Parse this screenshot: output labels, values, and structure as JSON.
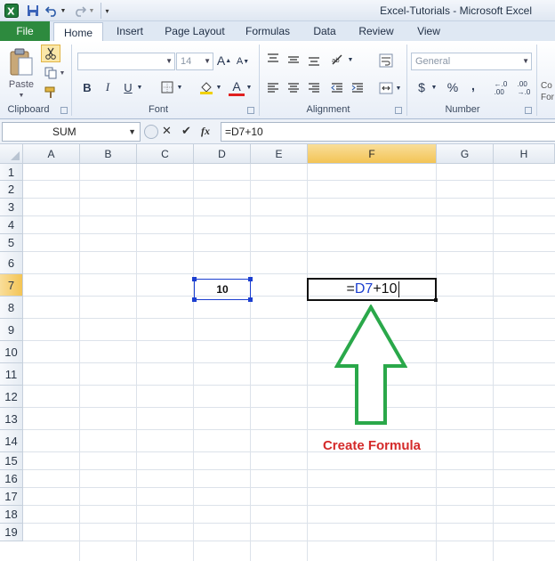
{
  "window": {
    "title": "Excel-Tutorials  -  Microsoft Excel"
  },
  "tabs": [
    {
      "label": "File"
    },
    {
      "label": "Home"
    },
    {
      "label": "Insert"
    },
    {
      "label": "Page Layout"
    },
    {
      "label": "Formulas"
    },
    {
      "label": "Data"
    },
    {
      "label": "Review"
    },
    {
      "label": "View"
    }
  ],
  "ribbon": {
    "clipboard": {
      "label": "Clipboard",
      "paste_label": "Paste"
    },
    "font": {
      "label": "Font",
      "font_name": "",
      "font_size": "14",
      "bold": "B",
      "italic": "I",
      "underline": "U"
    },
    "alignment": {
      "label": "Alignment"
    },
    "number": {
      "label": "Number",
      "format": "General",
      "currency": "$",
      "percent": "%",
      "comma": ",",
      "inc_decimal": "←.0\n.00",
      "dec_decimal": ".00\n→.0"
    },
    "styles": {
      "label_partial": "Co\nFor"
    }
  },
  "formula_bar": {
    "name_box": "SUM",
    "cancel_glyph": "✕",
    "enter_glyph": "✔",
    "fx_glyph": "fx",
    "formula": "=D7+10"
  },
  "sheet": {
    "columns": [
      "A",
      "B",
      "C",
      "D",
      "E",
      "F",
      "G",
      "H"
    ],
    "active_column": "F",
    "rows": [
      "1",
      "2",
      "3",
      "4",
      "5",
      "6",
      "7",
      "8",
      "9",
      "10",
      "11",
      "12",
      "13",
      "14",
      "15",
      "16",
      "17",
      "18",
      "19"
    ],
    "active_row": "7",
    "cells": {
      "D7": "10",
      "F7_prefix": "=",
      "F7_ref": "D7",
      "F7_suffix": "+10"
    }
  },
  "annotation": {
    "text": "Create Formula",
    "color": "#d42a2a",
    "arrow_color": "#2aa84a"
  },
  "colors": {
    "accent_file_tab": "#2d8a3e",
    "selection_blue": "#1c3fd0"
  }
}
